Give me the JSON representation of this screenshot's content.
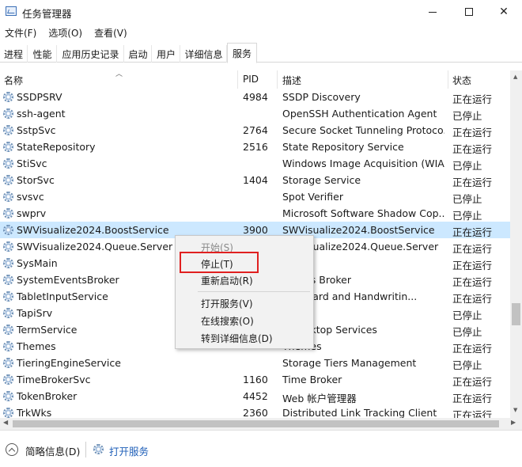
{
  "window": {
    "title": "任务管理器",
    "minimize_glyph": "",
    "close_glyph": "✕"
  },
  "menu": [
    "文件(F)",
    "选项(O)",
    "查看(V)"
  ],
  "tabs": [
    "进程",
    "性能",
    "应用历史记录",
    "启动",
    "用户",
    "详细信息",
    "服务"
  ],
  "active_tab": "服务",
  "columns": {
    "name": "名称",
    "pid": "PID",
    "desc": "描述",
    "status": "状态"
  },
  "rows": [
    {
      "name": "SSDPSRV",
      "pid": "4984",
      "desc": "SSDP Discovery",
      "status": "正在运行"
    },
    {
      "name": "ssh-agent",
      "pid": "",
      "desc": "OpenSSH Authentication Agent",
      "status": "已停止"
    },
    {
      "name": "SstpSvc",
      "pid": "2764",
      "desc": "Secure Socket Tunneling Protoco...",
      "status": "正在运行"
    },
    {
      "name": "StateRepository",
      "pid": "2516",
      "desc": "State Repository Service",
      "status": "正在运行"
    },
    {
      "name": "StiSvc",
      "pid": "",
      "desc": "Windows Image Acquisition (WIA)",
      "status": "已停止"
    },
    {
      "name": "StorSvc",
      "pid": "1404",
      "desc": "Storage Service",
      "status": "正在运行"
    },
    {
      "name": "svsvc",
      "pid": "",
      "desc": "Spot Verifier",
      "status": "已停止"
    },
    {
      "name": "swprv",
      "pid": "",
      "desc": "Microsoft Software Shadow Cop...",
      "status": "已停止"
    },
    {
      "name": "SWVisualize2024.BoostService",
      "pid": "3900",
      "desc": "SWVisualize2024.BoostService",
      "status": "正在运行"
    },
    {
      "name": "SWVisualize2024.Queue.Server",
      "pid": "",
      "desc": "SWVisualize2024.Queue.Server",
      "status": "正在运行"
    },
    {
      "name": "SysMain",
      "pid": "",
      "desc": "n",
      "status": "正在运行"
    },
    {
      "name": "SystemEventsBroker",
      "pid": "",
      "desc": "Events Broker",
      "status": "正在运行"
    },
    {
      "name": "TabletInputService",
      "pid": "",
      "desc": "Keyboard and Handwritin...",
      "status": "正在运行"
    },
    {
      "name": "TapiSrv",
      "pid": "",
      "desc": "ony",
      "status": "已停止"
    },
    {
      "name": "TermService",
      "pid": "",
      "desc": "e Desktop Services",
      "status": "已停止"
    },
    {
      "name": "Themes",
      "pid": "",
      "desc": "Themes",
      "status": "正在运行"
    },
    {
      "name": "TieringEngineService",
      "pid": "",
      "desc": "Storage Tiers Management",
      "status": "已停止"
    },
    {
      "name": "TimeBrokerSvc",
      "pid": "1160",
      "desc": "Time Broker",
      "status": "正在运行"
    },
    {
      "name": "TokenBroker",
      "pid": "4452",
      "desc": "Web 帐户管理器",
      "status": "正在运行"
    },
    {
      "name": "TrkWks",
      "pid": "2360",
      "desc": "Distributed Link Tracking Client",
      "status": "正在运行"
    }
  ],
  "selected_row": 8,
  "context_menu": {
    "start": "开始(S)",
    "stop": "停止(T)",
    "restart": "重新启动(R)",
    "open_services": "打开服务(V)",
    "search_online": "在线搜索(O)",
    "goto_details": "转到详细信息(D)"
  },
  "footer": {
    "collapse_label": "简略信息(D)",
    "open_services_link": "打开服务"
  },
  "colors": {
    "selected_row": "#cce8ff",
    "highlight_box": "#e02020",
    "link": "#1f5fb8"
  }
}
